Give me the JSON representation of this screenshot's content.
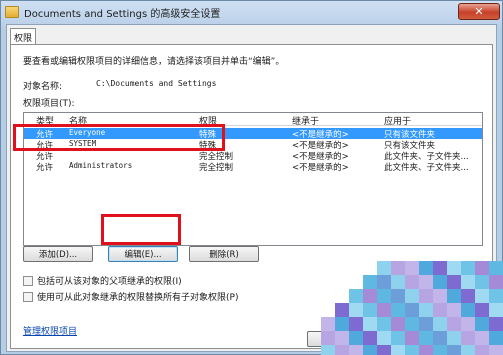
{
  "window": {
    "title": "Documents and Settings 的高级安全设置",
    "close_label": "✕"
  },
  "tabs": [
    {
      "label": "权限"
    }
  ],
  "panel": {
    "description": "要查看或编辑权限项目的详细信息，请选择该项目并单击“编辑”。",
    "object_label": "对象名称:",
    "object_value": "C:\\Documents and Settings",
    "entries_label": "权限项目(T):"
  },
  "list": {
    "headers": [
      "类型",
      "名称",
      "权限",
      "继承于",
      "应用于"
    ],
    "rows": [
      {
        "type": "允许",
        "name": "Everyone",
        "permission": "特殊",
        "inherited": "<不是继承的>",
        "applies": "只有该文件夹",
        "selected": true
      },
      {
        "type": "允许",
        "name": "SYSTEM",
        "permission": "特殊",
        "inherited": "<不是继承的>",
        "applies": "只有该文件夹",
        "selected": false
      },
      {
        "type": "允许",
        "name": "",
        "permission": "完全控制",
        "inherited": "<不是继承的>",
        "applies": "此文件夹、子文件夹...",
        "selected": false
      },
      {
        "type": "允许",
        "name": "Administrators",
        "permission": "完全控制",
        "inherited": "<不是继承的>",
        "applies": "此文件夹、子文件夹...",
        "selected": false
      }
    ]
  },
  "buttons": {
    "add": "添加(D)...",
    "edit": "编辑(E)...",
    "remove": "删除(R)"
  },
  "checkboxes": {
    "include_inheritable": "包括可从该对象的父项继承的权限(I)",
    "replace_child": "使用可从此对象继承的权限替换所有子对象权限(P)"
  },
  "link": {
    "manage": "管理权限项目"
  },
  "colors": {
    "highlight": "#e0101d",
    "selection": "#3399ff"
  }
}
